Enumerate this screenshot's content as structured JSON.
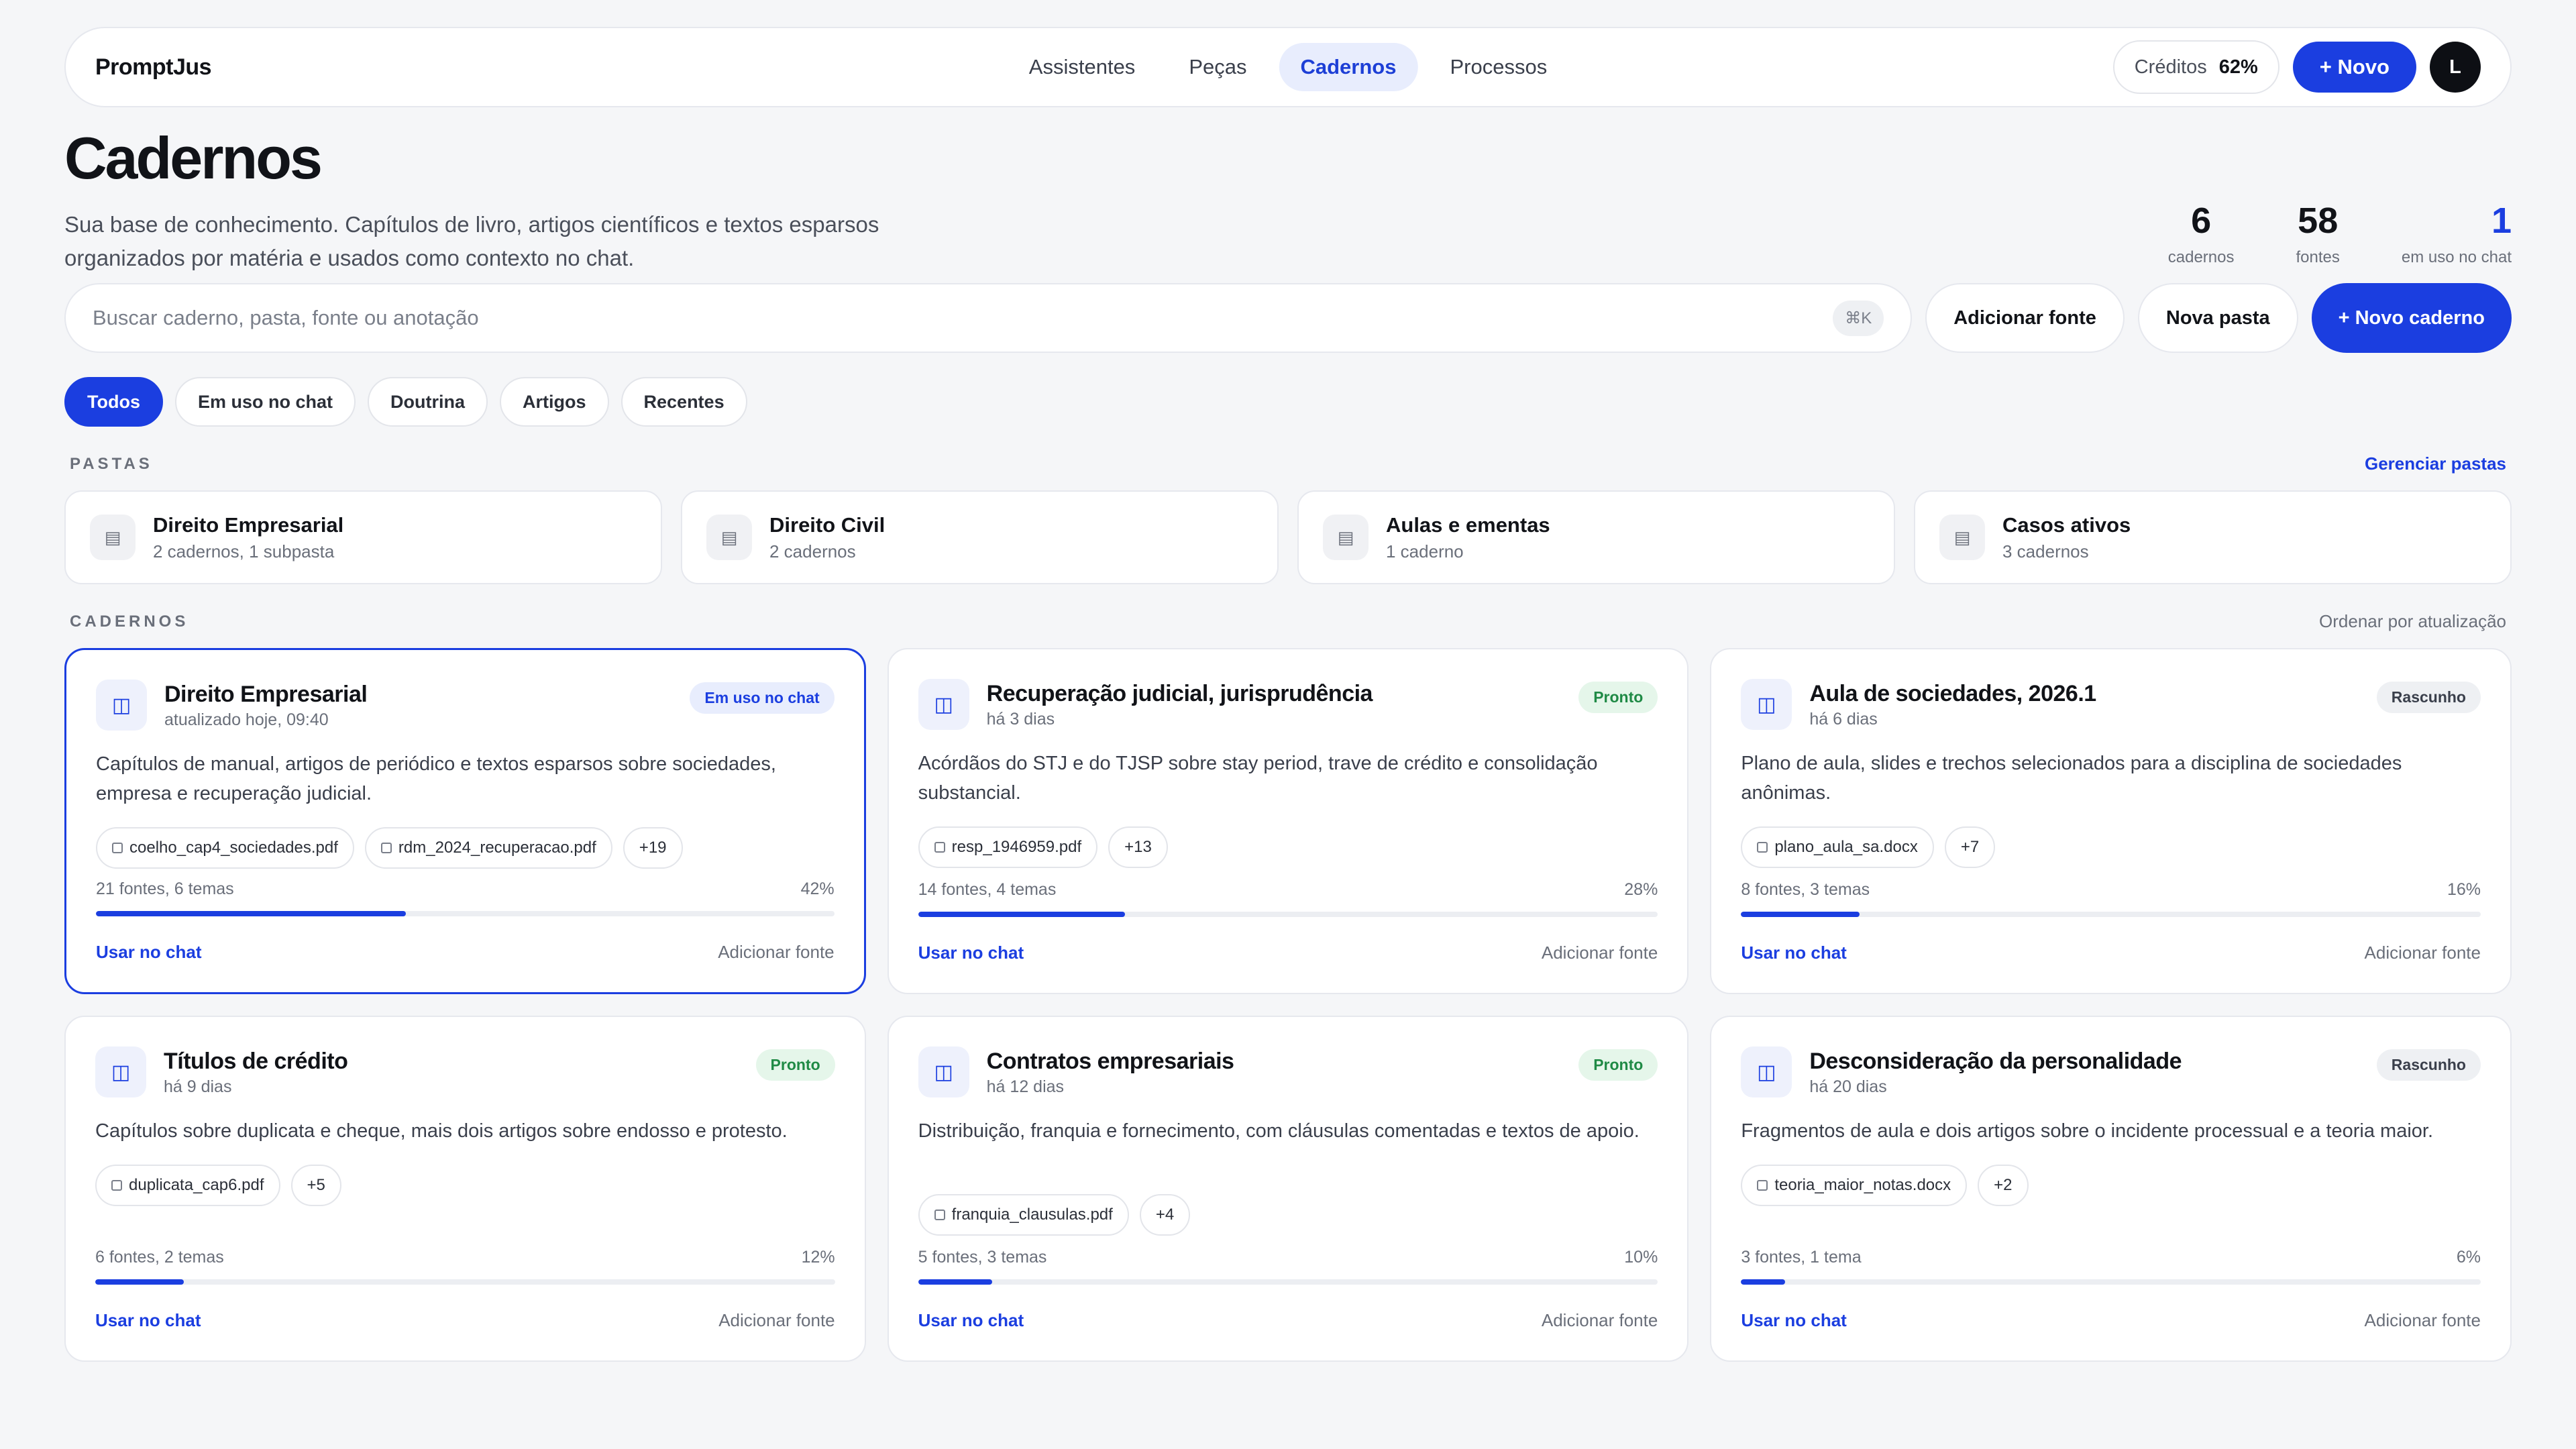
{
  "nav": {
    "brand": "PromptJus",
    "links": [
      {
        "label": "Assistentes",
        "active": false
      },
      {
        "label": "Peças",
        "active": false
      },
      {
        "label": "Cadernos",
        "active": true
      },
      {
        "label": "Processos",
        "active": false
      }
    ],
    "credits_label": "Créditos",
    "credits_value": "62%",
    "new_label": "+ Novo",
    "avatar_initial": "L"
  },
  "header": {
    "title": "Cadernos",
    "subtitle": "Sua base de conhecimento. Capítulos de livro, artigos científicos e textos esparsos organizados por matéria e usados como contexto no chat.",
    "stats": [
      {
        "value": "6",
        "label": "cadernos"
      },
      {
        "value": "58",
        "label": "fontes"
      },
      {
        "value": "1",
        "label": "em uso no chat"
      }
    ]
  },
  "search": {
    "placeholder": "Buscar caderno, pasta, fonte ou anotação",
    "shortcut": "⌘K"
  },
  "actions": {
    "add_source": "Adicionar fonte",
    "new_folder": "Nova pasta",
    "new_notebook": "+ Novo caderno"
  },
  "filters": [
    {
      "label": "Todos",
      "active": true
    },
    {
      "label": "Em uso no chat",
      "active": false
    },
    {
      "label": "Doutrina",
      "active": false
    },
    {
      "label": "Artigos",
      "active": false
    },
    {
      "label": "Recentes",
      "active": false
    }
  ],
  "folders_section": {
    "label": "PASTAS",
    "manage_link": "Gerenciar pastas",
    "items": [
      {
        "title": "Direito Empresarial",
        "sub": "2 cadernos, 1 subpasta"
      },
      {
        "title": "Direito Civil",
        "sub": "2 cadernos"
      },
      {
        "title": "Aulas e ementas",
        "sub": "1 caderno"
      },
      {
        "title": "Casos ativos",
        "sub": "3 cadernos"
      }
    ]
  },
  "notebooks_section": {
    "label": "CADERNOS",
    "sort_label": "Ordenar por atualização",
    "use_label": "Usar no chat",
    "add_label": "Adicionar fonte",
    "items": [
      {
        "title": "Direito Empresarial",
        "date": "atualizado hoje, 09:40",
        "badge": "Em uso no chat",
        "badge_style": "blue",
        "desc": "Capítulos de manual, artigos de periódico e textos esparsos sobre sociedades, empresa e recuperação judicial.",
        "files": [
          "coelho_cap4_sociedades.pdf",
          "rdm_2024_recuperacao.pdf"
        ],
        "more": "+19",
        "meta": "21 fontes, 6 temas",
        "pct_label": "42%",
        "progress": 0.42,
        "highlight": true
      },
      {
        "title": "Recuperação judicial, jurisprudência",
        "date": "há 3 dias",
        "badge": "Pronto",
        "badge_style": "green",
        "desc": "Acórdãos do STJ e do TJSP sobre stay period, trave de crédito e consolidação substancial.",
        "files": [
          "resp_1946959.pdf"
        ],
        "more": "+13",
        "meta": "14 fontes, 4 temas",
        "pct_label": "28%",
        "progress": 0.28,
        "highlight": false
      },
      {
        "title": "Aula de sociedades, 2026.1",
        "date": "há 6 dias",
        "badge": "Rascunho",
        "badge_style": "gray",
        "desc": "Plano de aula, slides e trechos selecionados para a disciplina de sociedades anônimas.",
        "files": [
          "plano_aula_sa.docx"
        ],
        "more": "+7",
        "meta": "8 fontes, 3 temas",
        "pct_label": "16%",
        "progress": 0.16,
        "highlight": false
      },
      {
        "title": "Títulos de crédito",
        "date": "há 9 dias",
        "badge": "Pronto",
        "badge_style": "green",
        "desc": "Capítulos sobre duplicata e cheque, mais dois artigos sobre endosso e protesto.",
        "files": [
          "duplicata_cap6.pdf"
        ],
        "more": "+5",
        "meta": "6 fontes, 2 temas",
        "pct_label": "12%",
        "progress": 0.12,
        "highlight": false,
        "short": true
      },
      {
        "title": "Contratos empresariais",
        "date": "há 12 dias",
        "badge": "Pronto",
        "badge_style": "green",
        "desc": "Distribuição, franquia e fornecimento, com cláusulas comentadas e textos de apoio.",
        "files": [
          "franquia_clausulas.pdf"
        ],
        "more": "+4",
        "meta": "5 fontes, 3 temas",
        "pct_label": "10%",
        "progress": 0.1,
        "highlight": false
      },
      {
        "title": "Desconsideração da personalidade",
        "date": "há 20 dias",
        "badge": "Rascunho",
        "badge_style": "gray",
        "desc": "Fragmentos de aula e dois artigos sobre o incidente processual e a teoria maior.",
        "files": [
          "teoria_maior_notas.docx"
        ],
        "more": "+2",
        "meta": "3 fontes, 1 tema",
        "pct_label": "6%",
        "progress": 0.06,
        "highlight": false,
        "short": true
      }
    ]
  },
  "colors": {
    "accent": "#1b3ee0",
    "background": "#f5f6f8",
    "ready_green": "#1f8a45"
  }
}
